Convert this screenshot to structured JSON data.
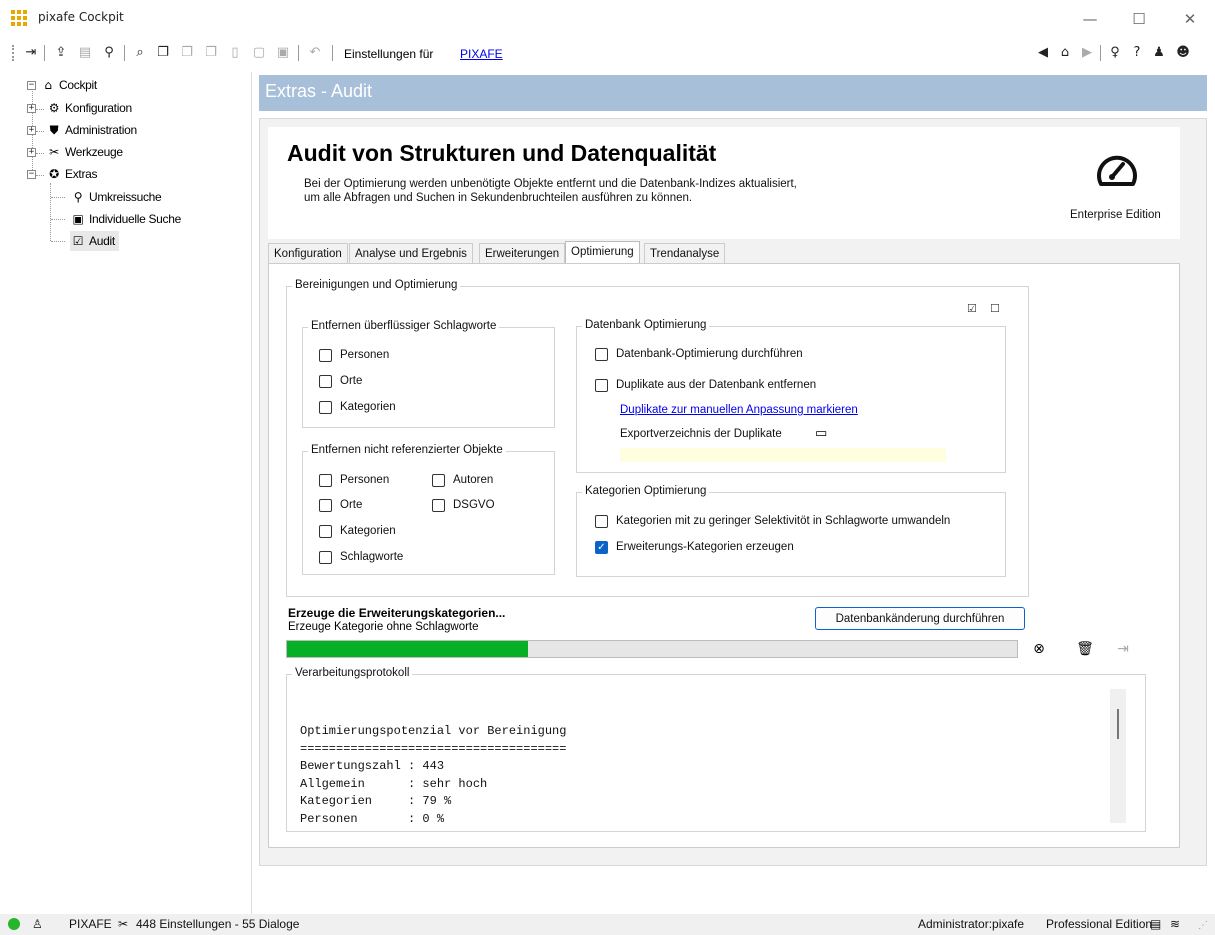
{
  "window": {
    "title": "pixafe Cockpit",
    "controls": [
      "—",
      "☐",
      "✕"
    ]
  },
  "toolbar": {
    "settings_for_label": "Einstellungen für",
    "settings_for_link": "PIXAFE"
  },
  "tree": {
    "root": "Cockpit",
    "items": [
      {
        "label": "Konfiguration"
      },
      {
        "label": "Administration"
      },
      {
        "label": "Werkzeuge"
      },
      {
        "label": "Extras"
      }
    ],
    "extras_children": [
      {
        "label": "Umkreissuche"
      },
      {
        "label": "Individuelle Suche"
      },
      {
        "label": "Audit"
      }
    ]
  },
  "page": {
    "title": "Extras - Audit",
    "heading": "Audit von Strukturen und Datenqualität",
    "desc_line1": "Bei der Optimierung werden unbenötigte Objekte entfernt und die Datenbank-Indizes aktualisiert,",
    "desc_line2": "um alle Abfragen und Suchen in Sekundenbruchteilen ausführen zu können.",
    "edition": "Enterprise Edition"
  },
  "tabs": [
    {
      "label": "Konfiguration"
    },
    {
      "label": "Analyse und Ergebnis"
    },
    {
      "label": "Erweiterungen"
    },
    {
      "label": "Optimierung",
      "active": true
    },
    {
      "label": "Trendanalyse"
    }
  ],
  "optimization": {
    "group_title": "Bereinigungen und Optimierung",
    "select_all_checked": true,
    "select_none_checked": false,
    "remove_keywords": {
      "title": "Entfernen überflüssiger Schlagworte",
      "items": [
        {
          "label": "Personen",
          "checked": false
        },
        {
          "label": "Orte",
          "checked": false
        },
        {
          "label": "Kategorien",
          "checked": false
        }
      ]
    },
    "remove_unreferenced": {
      "title": "Entfernen nicht referenzierter Objekte",
      "items": [
        {
          "label": "Personen",
          "checked": false
        },
        {
          "label": "Autoren",
          "checked": false
        },
        {
          "label": "Orte",
          "checked": false
        },
        {
          "label": "DSGVO",
          "checked": false
        },
        {
          "label": "Kategorien",
          "checked": false
        },
        {
          "label": "Schlagworte",
          "checked": false
        }
      ]
    },
    "database": {
      "title": "Datenbank Optimierung",
      "optimize": {
        "label": "Datenbank-Optimierung durchführen",
        "checked": false
      },
      "remove_duplicates": {
        "label": "Duplikate aus der Datenbank entfernen",
        "checked": false
      },
      "mark_duplicates_link": "Duplikate zur manuellen Anpassung markieren",
      "export_dir_label": "Exportverzeichnis der Duplikate",
      "export_dir_value": ""
    },
    "categories": {
      "title": "Kategorien Optimierung",
      "convert": {
        "label": "Kategorien mit zu geringer Selektivitöt in Schlagworte umwandeln",
        "checked": false
      },
      "extend": {
        "label": "Erweiterungs-Kategorien erzeugen",
        "checked": true
      }
    }
  },
  "status": {
    "operation": "Erzeuge die Erweiterungskategorien...",
    "sub_operation": "Erzeuge Kategorie ohne Schlagworte",
    "execute_button": "Datenbankänderung durchführen",
    "progress_fraction": 0.33
  },
  "log": {
    "title": "Verarbeitungsprotokoll",
    "lines": [
      "Optimierungspotenzial vor Bereinigung",
      "=====================================",
      "Bewertungszahl : 443",
      "Allgemein      : sehr hoch",
      "Kategorien     : 79 %",
      "Personen       : 0 %"
    ]
  },
  "statusbar": {
    "instance": "PIXAFE",
    "info": "448 Einstellungen - 55 Dialoge",
    "user": "Administrator:pixafe",
    "edition": "Professional Edition"
  },
  "colors": {
    "header_band": "#a7bfd8",
    "progress": "#06b025",
    "accent": "#0a64c8",
    "link": "#0000ee"
  }
}
